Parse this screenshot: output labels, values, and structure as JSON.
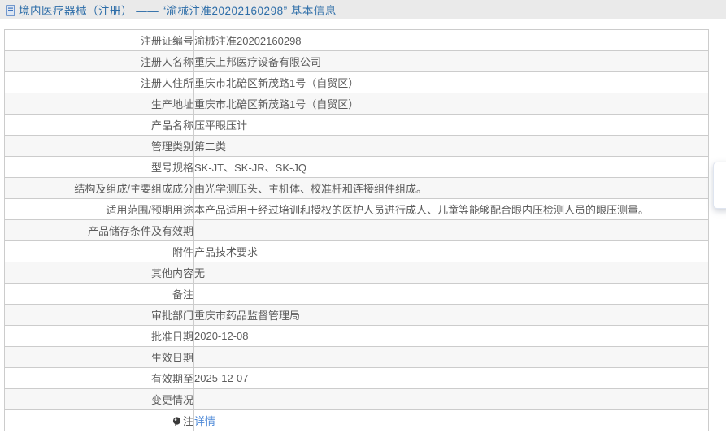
{
  "header": {
    "icon": "document-icon",
    "title": "境内医疗器械（注册） —— “渝械注准20202160298” 基本信息"
  },
  "table": {
    "rows": [
      {
        "label": "注册证编号",
        "value": "渝械注准20202160298"
      },
      {
        "label": "注册人名称",
        "value": "重庆上邦医疗设备有限公司"
      },
      {
        "label": "注册人住所",
        "value": "重庆市北碚区新茂路1号（自贸区）"
      },
      {
        "label": "生产地址",
        "value": "重庆市北碚区新茂路1号（自贸区）"
      },
      {
        "label": "产品名称",
        "value": "压平眼压计"
      },
      {
        "label": "管理类别",
        "value": "第二类"
      },
      {
        "label": "型号规格",
        "value": "SK-JT、SK-JR、SK-JQ"
      },
      {
        "label": "结构及组成/主要组成成分",
        "value": "由光学测压头、主机体、校准杆和连接组件组成。"
      },
      {
        "label": "适用范围/预期用途",
        "value": "本产品适用于经过培训和授权的医护人员进行成人、儿童等能够配合眼内压检测人员的眼压测量。"
      },
      {
        "label": "产品储存条件及有效期",
        "value": ""
      },
      {
        "label": "附件",
        "value": "产品技术要求"
      },
      {
        "label": "其他内容",
        "value": "无"
      },
      {
        "label": "备注",
        "value": ""
      },
      {
        "label": "审批部门",
        "value": "重庆市药品监督管理局"
      },
      {
        "label": "批准日期",
        "value": "2020-12-08"
      },
      {
        "label": "生效日期",
        "value": ""
      },
      {
        "label": "有效期至",
        "value": "2025-12-07"
      },
      {
        "label": "变更情况",
        "value": ""
      },
      {
        "label": "注",
        "label_icon": "comment-icon",
        "value": "详情",
        "value_link": true
      }
    ]
  },
  "colors": {
    "header_band_bg": "#eaeaea",
    "title_blue": "#2d6da8",
    "table_border": "#cccccc",
    "stripe_gray": "#f7f7f7",
    "text_gray": "#5c5c5c",
    "link_blue": "#4f8ad8",
    "doc_icon_blue": "#3f74bf",
    "note_icon_dark": "#3a3a3a"
  }
}
